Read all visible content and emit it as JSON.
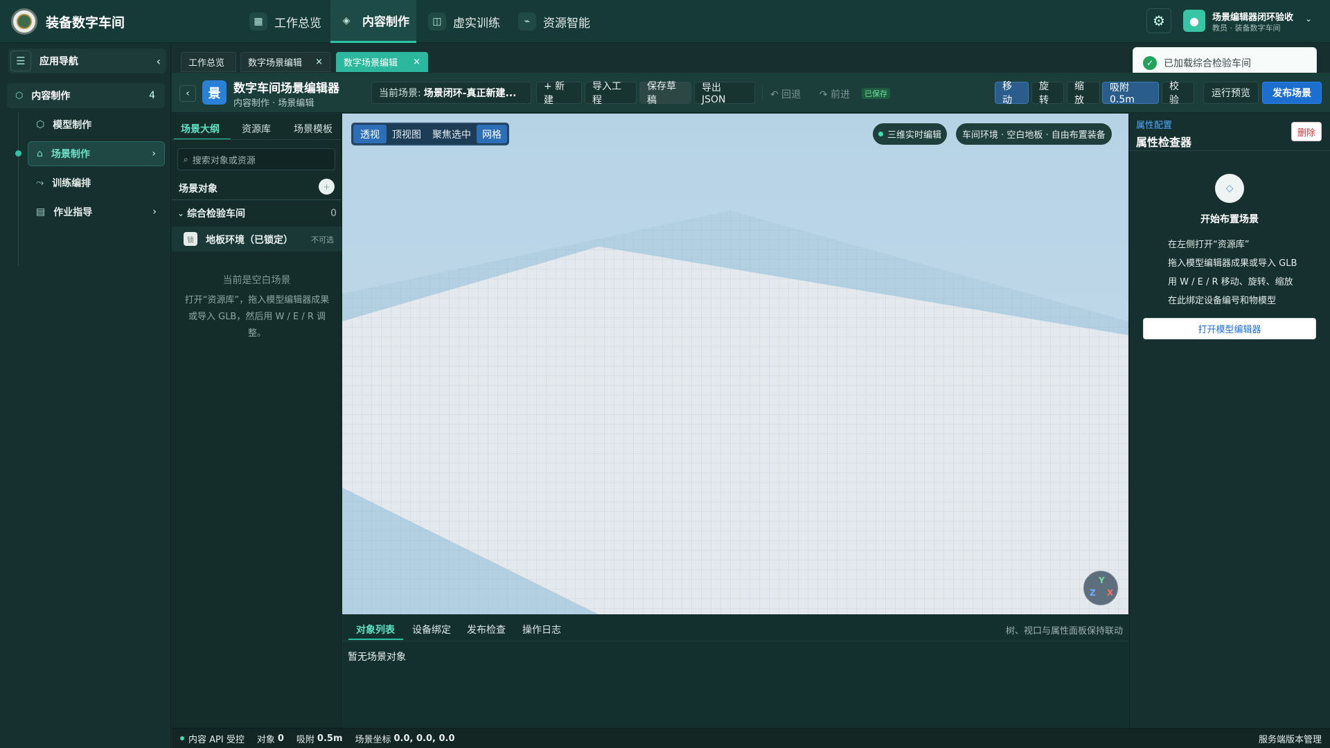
{
  "app": {
    "brand": "装备数字车间",
    "nav": [
      {
        "label": "工作总览",
        "icon": "grid-icon",
        "active": false
      },
      {
        "label": "内容制作",
        "icon": "cube-icon",
        "active": true
      },
      {
        "label": "虚实训练",
        "icon": "book-icon",
        "active": false
      },
      {
        "label": "资源智能",
        "icon": "plug-icon",
        "active": false
      }
    ],
    "user": {
      "name": "场景编辑器闭环验收",
      "role": "教员 · 装备数字车间"
    }
  },
  "sidebar": {
    "title": "应用导航",
    "section": {
      "label": "内容制作",
      "count": "4"
    },
    "items": [
      {
        "label": "模型制作",
        "icon": "cube-icon",
        "active": false,
        "chevron": false
      },
      {
        "label": "场景制作",
        "icon": "home-icon",
        "active": true,
        "chevron": true
      },
      {
        "label": "训练编排",
        "icon": "flow-icon",
        "active": false,
        "chevron": false
      },
      {
        "label": "作业指导",
        "icon": "doc-icon",
        "active": false,
        "chevron": true
      }
    ]
  },
  "page_tabs": [
    {
      "label": "工作总览",
      "closable": false,
      "active": false
    },
    {
      "label": "数字场景编辑",
      "closable": true,
      "active": false
    },
    {
      "label": "数字场景编辑",
      "closable": true,
      "active": true
    }
  ],
  "toolbar": {
    "badge": "景",
    "title": "数字车间场景编辑器",
    "breadcrumb": "内容制作 · 场景编辑",
    "scene_prefix": "当前场景:",
    "scene_name": "场景闭环-真正新建...",
    "new": "+ 新建",
    "import": "导入工程",
    "save_draft": "保存草稿",
    "export": "导出 JSON",
    "undo": "↶ 回退",
    "redo": "↷ 前进",
    "saved": "已保存",
    "move": "移动",
    "rotate": "旋转",
    "scale": "缩放",
    "snap": "吸附 0.5m",
    "validate": "校验",
    "preview": "运行预览",
    "publish": "发布场景"
  },
  "outline": {
    "tabs": [
      "场景大纲",
      "资源库",
      "场景模板"
    ],
    "search_placeholder": "搜索对象或资源",
    "objects_label": "场景对象",
    "group_label": "综合检验车间",
    "group_count": "0",
    "floor_label": "地板环境（已锁定）",
    "floor_badge": "锁",
    "floor_status": "不可选",
    "empty_title": "当前是空白场景",
    "empty_desc": "打开“资源库”，拖入模型编辑器成果或导入 GLB，然后用 W / E / R 调整。"
  },
  "viewport": {
    "view_buttons": [
      "透视",
      "顶视图",
      "聚焦选中",
      "网格"
    ],
    "live_label": "三维实时编辑",
    "env_label": "车间环境 · 空白地板 · 自由布置装备",
    "axes": {
      "y": "Y",
      "z": "Z",
      "x": "X"
    }
  },
  "bottom": {
    "tabs": [
      "对象列表",
      "设备绑定",
      "发布检查",
      "操作日志"
    ],
    "hint": "树、视口与属性面板保持联动",
    "empty": "暂无场景对象"
  },
  "inspector": {
    "eyebrow": "属性配置",
    "title": "属性检查器",
    "delete": "删除",
    "start_title": "开始布置场景",
    "steps": [
      "在左侧打开“资源库”",
      "拖入模型编辑器成果或导入 GLB",
      "用 W / E / R 移动、旋转、缩放",
      "在此绑定设备编号和物模型"
    ],
    "open_editor": "打开模型编辑器"
  },
  "status": {
    "api": "内容 API 受控",
    "objects_label": "对象",
    "objects_value": "0",
    "snap_label": "吸附",
    "snap_value": "0.5m",
    "coord_label": "场景坐标",
    "coord_value": "0.0, 0.0, 0.0",
    "right": "服务端版本管理"
  },
  "toast": {
    "text": "已加载综合检验车间"
  },
  "colors": {
    "accent": "#2cc3a6",
    "primary": "#1d6fcf",
    "danger": "#d9363e",
    "success": "#22a35b"
  }
}
